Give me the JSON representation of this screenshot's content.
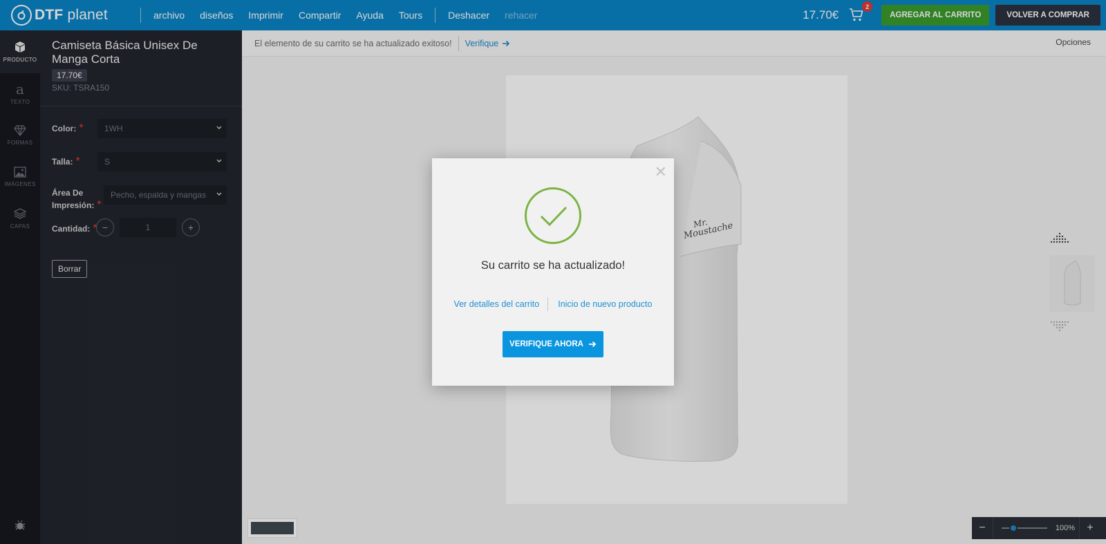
{
  "brand": {
    "name_bold": "DTF",
    "name_rest": " planet"
  },
  "menu": [
    {
      "label": "archivo",
      "state": "enabled"
    },
    {
      "label": "diseños",
      "state": "enabled"
    },
    {
      "label": "Imprimir",
      "state": "enabled"
    },
    {
      "label": "Compartir",
      "state": "enabled"
    },
    {
      "label": "Ayuda",
      "state": "enabled"
    },
    {
      "label": "Tours",
      "state": "enabled"
    }
  ],
  "history": {
    "undo": "Deshacer",
    "redo": "rehacer"
  },
  "cart": {
    "total": "17.70€",
    "count": "2"
  },
  "buttons": {
    "add_to_cart": "AGREGAR AL CARRITO",
    "back_to_shop": "VOLVER A COMPRAR"
  },
  "rail": [
    {
      "label": "PRODUCTO",
      "icon": "box-icon",
      "active": true
    },
    {
      "label": "TEXTO",
      "icon": "text-icon",
      "active": false
    },
    {
      "label": "FORMAS",
      "icon": "diamond-icon",
      "active": false
    },
    {
      "label": "IMÁGENES",
      "icon": "image-icon",
      "active": false
    },
    {
      "label": "CAPAS",
      "icon": "layers-icon",
      "active": false
    }
  ],
  "product": {
    "title": "Camiseta Básica Unisex De Manga Corta",
    "price": "17.70€",
    "sku": "SKU: TSRA150",
    "color_label": "Color:",
    "color_value": "1WH",
    "size_label": "Talla:",
    "size_value": "S",
    "area_label": "Área De Impresión:",
    "area_value": "Pecho, espalda y mangas",
    "qty_label": "Cantidad:",
    "qty_value": "1",
    "clear_label": "Borrar"
  },
  "notice": {
    "message": "El elemento de su carrito se ha actualizado exitoso!",
    "link": "Verifique"
  },
  "options_label": "Opciones",
  "design_text": {
    "line1": "Mr.",
    "line2": "Moustache"
  },
  "zoom": {
    "value": "100%",
    "level": 0.25
  },
  "colors": {
    "topbar": "#0a84c6",
    "add_button": "#3a9b2d",
    "accent": "#0a95de",
    "success": "#7cb342"
  },
  "modal": {
    "title": "Su carrito se ha actualizado!",
    "link_details": "Ver detalles del carrito",
    "link_new": "Inicio de nuevo producto",
    "cta": "VERIFIQUE AHORA"
  }
}
